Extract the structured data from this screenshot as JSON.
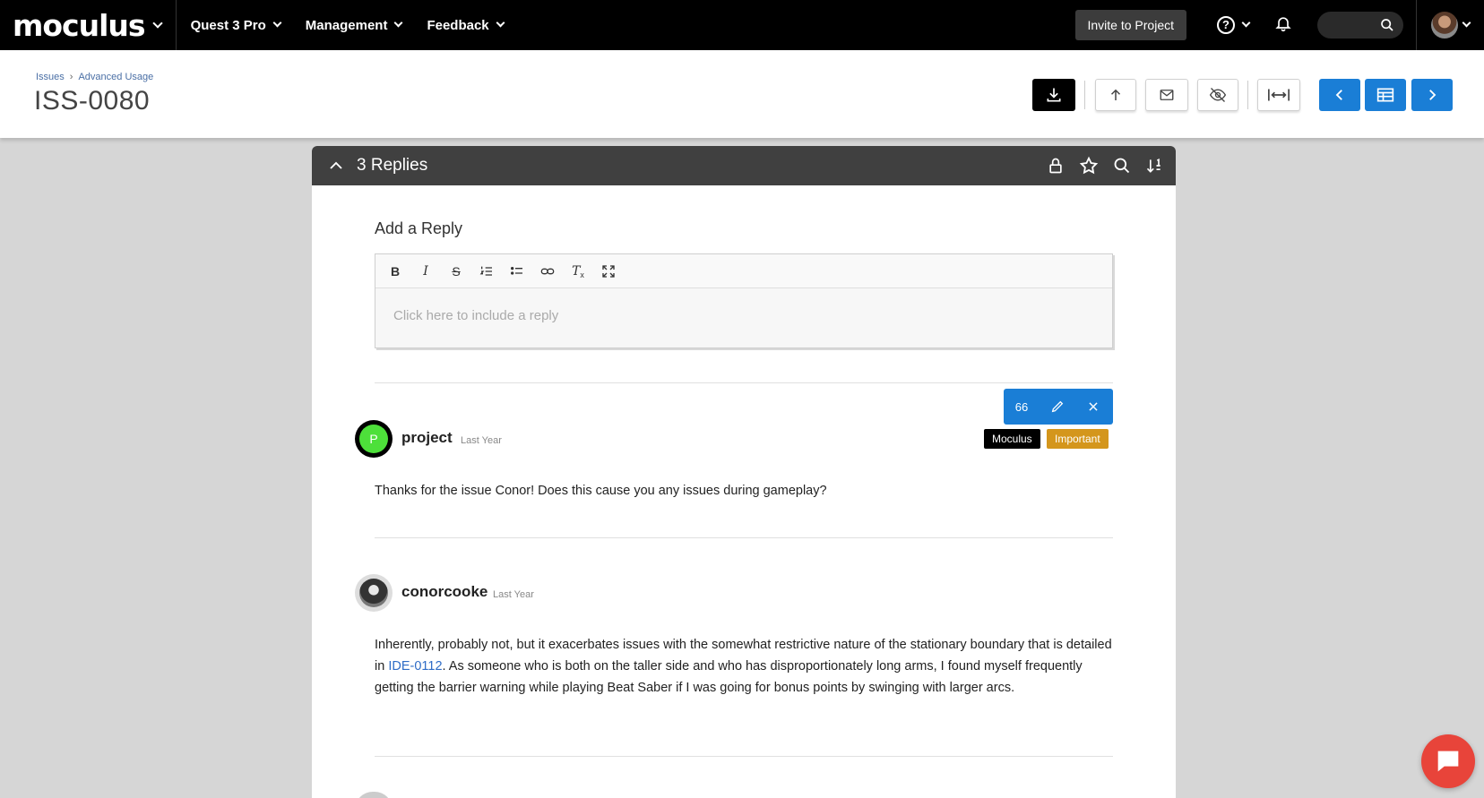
{
  "topbar": {
    "brand": "moculus",
    "nav": [
      "Quest 3 Pro",
      "Management",
      "Feedback"
    ],
    "invite_label": "Invite to Project",
    "help_label": "?"
  },
  "header": {
    "breadcrumb": [
      "Issues",
      "Advanced Usage"
    ],
    "title": "ISS-0080"
  },
  "replies": {
    "title": "3 Replies",
    "add_reply_label": "Add a Reply",
    "editor_placeholder": "Click here to include a reply",
    "float_count": "66",
    "items": [
      {
        "username": "project",
        "avatar_letter": "P",
        "time": "Last Year",
        "tags": [
          "Moculus",
          "Important"
        ],
        "text": "Thanks for the issue Conor! Does this cause you any issues during gameplay?"
      },
      {
        "username": "conorcooke",
        "time": "Last Year",
        "text_before": "Inherently, probably not, but it exacerbates issues with the somewhat restrictive nature of the stationary boundary that is detailed in ",
        "link": "IDE-0112",
        "text_after": ". As someone who is both on the taller side and who has disproportionately long arms, I found myself frequently getting the barrier warning while playing Beat Saber if I was going for bonus points by swinging with larger arcs."
      }
    ]
  },
  "colors": {
    "accent": "#1a7ed6",
    "tag_dark": "#000000",
    "tag_important": "#d4961c",
    "chat": "#e8443a"
  }
}
